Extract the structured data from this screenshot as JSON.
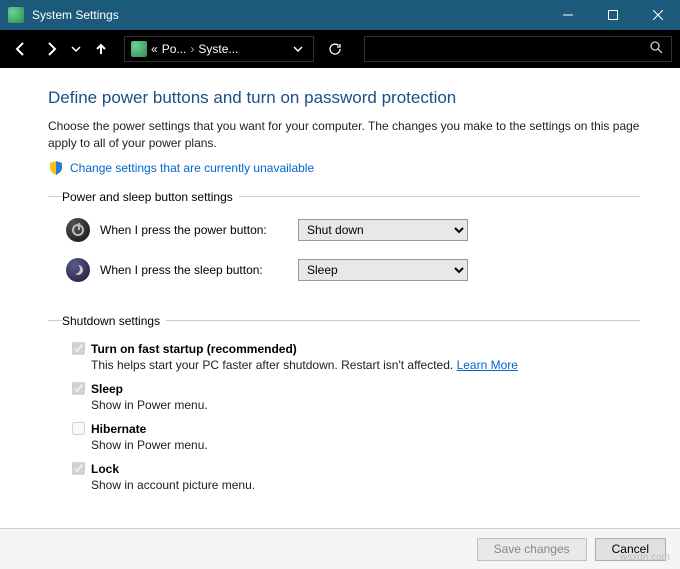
{
  "titlebar": {
    "title": "System Settings"
  },
  "nav": {
    "breadcrumb_prefix": "«",
    "breadcrumb_seg1": "Po...",
    "breadcrumb_seg2": "Syste..."
  },
  "page": {
    "title": "Define power buttons and turn on password protection",
    "description": "Choose the power settings that you want for your computer. The changes you make to the settings on this page apply to all of your power plans.",
    "change_link": "Change settings that are currently unavailable"
  },
  "power_sleep": {
    "legend": "Power and sleep button settings",
    "power_label": "When I press the power button:",
    "power_value": "Shut down",
    "sleep_label": "When I press the sleep button:",
    "sleep_value": "Sleep"
  },
  "shutdown": {
    "legend": "Shutdown settings",
    "items": [
      {
        "checked": true,
        "label": "Turn on fast startup (recommended)",
        "desc": "This helps start your PC faster after shutdown. Restart isn't affected.",
        "learn_more": "Learn More"
      },
      {
        "checked": true,
        "label": "Sleep",
        "desc": "Show in Power menu."
      },
      {
        "checked": false,
        "label": "Hibernate",
        "desc": "Show in Power menu."
      },
      {
        "checked": true,
        "label": "Lock",
        "desc": "Show in account picture menu."
      }
    ]
  },
  "footer": {
    "save": "Save changes",
    "cancel": "Cancel"
  },
  "watermark": "wsxdn.com"
}
